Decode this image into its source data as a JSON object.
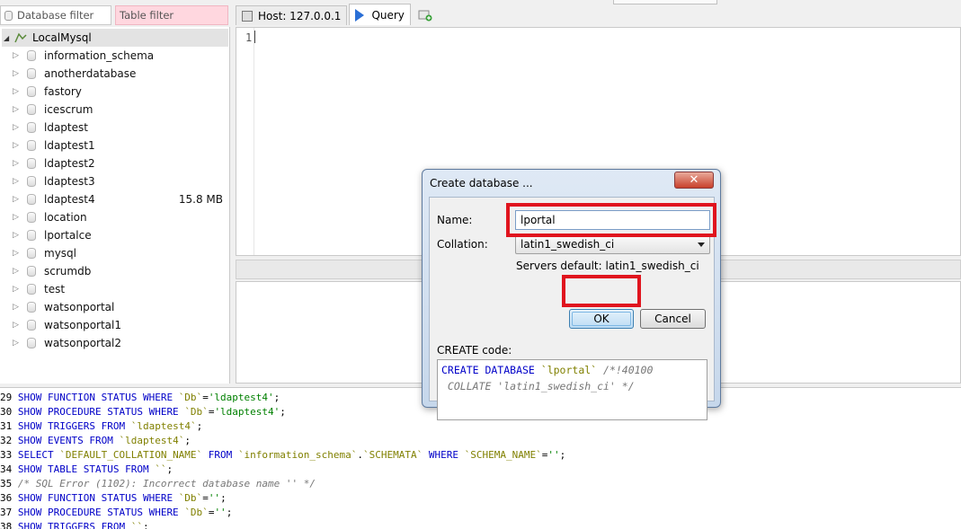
{
  "filters": {
    "database_filter": "Database filter",
    "table_filter": "Table filter"
  },
  "tree": {
    "root_label": "LocalMysql",
    "databases": [
      {
        "name": "information_schema",
        "size": ""
      },
      {
        "name": "anotherdatabase",
        "size": ""
      },
      {
        "name": "fastory",
        "size": ""
      },
      {
        "name": "icescrum",
        "size": ""
      },
      {
        "name": "ldaptest",
        "size": ""
      },
      {
        "name": "ldaptest1",
        "size": ""
      },
      {
        "name": "ldaptest2",
        "size": ""
      },
      {
        "name": "ldaptest3",
        "size": ""
      },
      {
        "name": "ldaptest4",
        "size": "15.8 MB"
      },
      {
        "name": "location",
        "size": ""
      },
      {
        "name": "lportalce",
        "size": ""
      },
      {
        "name": "mysql",
        "size": ""
      },
      {
        "name": "scrumdb",
        "size": ""
      },
      {
        "name": "test",
        "size": ""
      },
      {
        "name": "watsonportal",
        "size": ""
      },
      {
        "name": "watsonportal1",
        "size": ""
      },
      {
        "name": "watsonportal2",
        "size": ""
      }
    ]
  },
  "tabs": {
    "host": "Host: 127.0.0.1",
    "query": "Query"
  },
  "editor": {
    "line_number": "1"
  },
  "log": [
    {
      "n": "29",
      "parts": [
        [
          "kw",
          "SHOW FUNCTION STATUS WHERE "
        ],
        [
          "id",
          "`Db`"
        ],
        [
          "n",
          "="
        ],
        [
          "st",
          "'ldaptest4'"
        ],
        [
          "n",
          ";"
        ]
      ]
    },
    {
      "n": "30",
      "parts": [
        [
          "kw",
          "SHOW PROCEDURE STATUS WHERE "
        ],
        [
          "id",
          "`Db`"
        ],
        [
          "n",
          "="
        ],
        [
          "st",
          "'ldaptest4'"
        ],
        [
          "n",
          ";"
        ]
      ]
    },
    {
      "n": "31",
      "parts": [
        [
          "kw",
          "SHOW TRIGGERS FROM "
        ],
        [
          "id",
          "`ldaptest4`"
        ],
        [
          "n",
          ";"
        ]
      ]
    },
    {
      "n": "32",
      "parts": [
        [
          "kw",
          "SHOW EVENTS FROM "
        ],
        [
          "id",
          "`ldaptest4`"
        ],
        [
          "n",
          ";"
        ]
      ]
    },
    {
      "n": "33",
      "parts": [
        [
          "kw",
          "SELECT "
        ],
        [
          "id",
          "`DEFAULT_COLLATION_NAME`"
        ],
        [
          "kw",
          " FROM "
        ],
        [
          "id",
          "`information_schema`"
        ],
        [
          "n",
          "."
        ],
        [
          "id",
          "`SCHEMATA`"
        ],
        [
          "kw",
          " WHERE "
        ],
        [
          "id",
          "`SCHEMA_NAME`"
        ],
        [
          "n",
          "="
        ],
        [
          "st",
          "''"
        ],
        [
          "n",
          ";"
        ]
      ]
    },
    {
      "n": "34",
      "parts": [
        [
          "kw",
          "SHOW TABLE STATUS FROM "
        ],
        [
          "id",
          "``"
        ],
        [
          "n",
          ";"
        ]
      ]
    },
    {
      "n": "35",
      "parts": [
        [
          "cm",
          "/* SQL Error (1102): Incorrect database name '' */"
        ]
      ]
    },
    {
      "n": "36",
      "parts": [
        [
          "kw",
          "SHOW FUNCTION STATUS WHERE "
        ],
        [
          "id",
          "`Db`"
        ],
        [
          "n",
          "="
        ],
        [
          "st",
          "''"
        ],
        [
          "n",
          ";"
        ]
      ]
    },
    {
      "n": "37",
      "parts": [
        [
          "kw",
          "SHOW PROCEDURE STATUS WHERE "
        ],
        [
          "id",
          "`Db`"
        ],
        [
          "n",
          "="
        ],
        [
          "st",
          "''"
        ],
        [
          "n",
          ";"
        ]
      ]
    },
    {
      "n": "38",
      "parts": [
        [
          "kw",
          "SHOW TRIGGERS FROM "
        ],
        [
          "id",
          "``"
        ],
        [
          "n",
          ";"
        ]
      ]
    }
  ],
  "dialog": {
    "title": "Create database ...",
    "close_label": "✕",
    "name_label": "Name:",
    "name_value": "lportal",
    "collation_label": "Collation:",
    "collation_value": "latin1_swedish_ci",
    "server_default": "Servers default: latin1_swedish_ci",
    "ok_label": "OK",
    "cancel_label": "Cancel",
    "create_code_label": "CREATE code:",
    "create_code": [
      [
        [
          "kw",
          "CREATE DATABASE "
        ],
        [
          "id",
          "`lportal`"
        ],
        [
          "cm",
          " /*!40100"
        ]
      ],
      [
        [
          "cm",
          " COLLATE 'latin1_swedish_ci' */"
        ]
      ]
    ]
  }
}
